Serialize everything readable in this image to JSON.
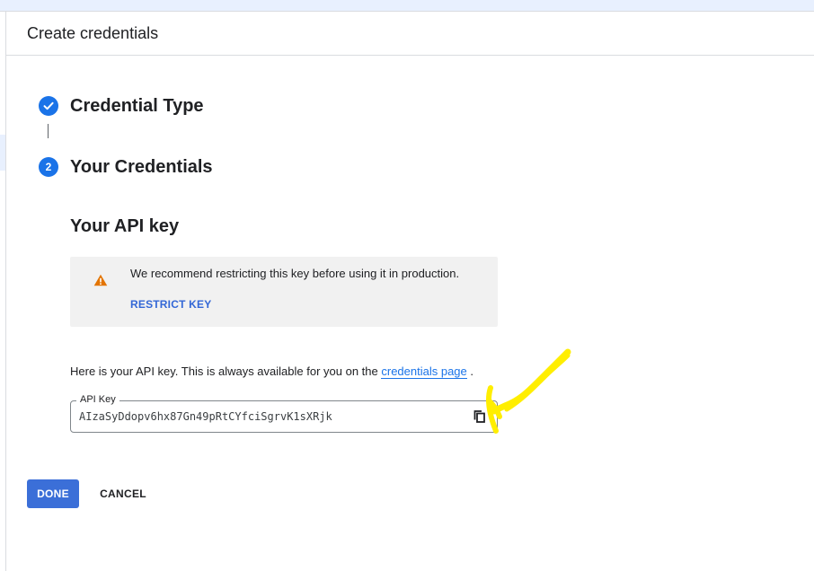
{
  "dialog": {
    "title": "Create credentials"
  },
  "stepper": {
    "steps": [
      {
        "label": "Credential Type",
        "state": "completed",
        "icon": "check-icon"
      },
      {
        "label": "Your Credentials",
        "state": "current",
        "number": "2"
      }
    ]
  },
  "api_key_section": {
    "title": "Your API key",
    "warning": {
      "icon": "warning-icon",
      "message": "We recommend restricting this key before using it in production.",
      "action_label": "RESTRICT KEY"
    },
    "info_text_prefix": "Here is your API key. This is always available for you on the ",
    "info_link_label": "credentials page",
    "info_text_suffix": " .",
    "key_field": {
      "label": "API Key",
      "value": "AIzaSyDdopv6hx87Gn49pRtCYfciSgrvK1sXRjk",
      "copy_icon": "copy-icon"
    }
  },
  "actions": {
    "done_label": "DONE",
    "cancel_label": "CANCEL"
  },
  "colors": {
    "accent": "#1a73e8",
    "button_primary": "#3b6fd8",
    "warning": "#e37400",
    "highlight": "#ffee00"
  }
}
